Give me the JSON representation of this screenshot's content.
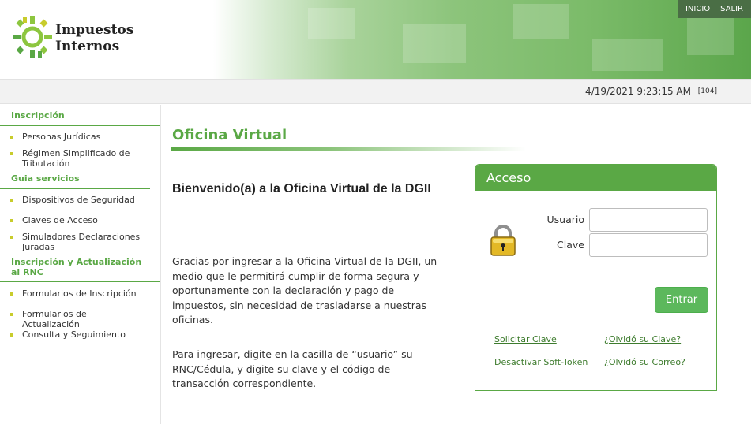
{
  "header": {
    "logo_line1": "Impuestos",
    "logo_line2": "Internos",
    "nav": [
      "INICIO",
      "SALIR"
    ]
  },
  "datebar": {
    "datetime": "4/19/2021 9:23:15 AM",
    "code": "[104]"
  },
  "sidebar": {
    "sections": [
      {
        "heading": "Inscripción",
        "items": [
          "Personas Jurídicas",
          "Régimen Simplificado de Tributación"
        ]
      },
      {
        "heading": "Guia servicios",
        "items": [
          "Dispositivos de Seguridad",
          "Claves de Acceso",
          "Simuladores Declaraciones Juradas"
        ]
      },
      {
        "heading": "Inscripción y Actualización al RNC",
        "items": [
          "Formularios de Inscripción",
          "Formularios de Actualización",
          "Consulta y Seguimiento"
        ]
      }
    ]
  },
  "main": {
    "title": "Oficina Virtual",
    "welcome": "Bienvenido(a) a la Oficina Virtual de la DGII",
    "para1": "Gracias por ingresar a la Oficina Virtual de la DGII, un medio que le permitirá cumplir de forma segura y oportunamente con la declaración y pago de impuestos, sin necesidad de trasladarse a nuestras oficinas.",
    "para2": "Para ingresar, digite en la casilla de “usuario” su RNC/Cédula, y digite su clave y el código de transacción correspondiente."
  },
  "login": {
    "title": "Acceso",
    "user_label": "Usuario",
    "user_value": "",
    "pass_label": "Clave",
    "pass_value": "",
    "enter_label": "Entrar",
    "links": {
      "request_key": "Solicitar Clave",
      "forgot_key": "¿Olvidó su Clave?",
      "deactivate_token": "Desactivar Soft-Token",
      "forgot_email": "¿Olvidó su Correo?"
    }
  },
  "colors": {
    "brand_green": "#5aa845",
    "bullet": "#c8cc2c",
    "topnav_bg": "#4a6e45"
  }
}
